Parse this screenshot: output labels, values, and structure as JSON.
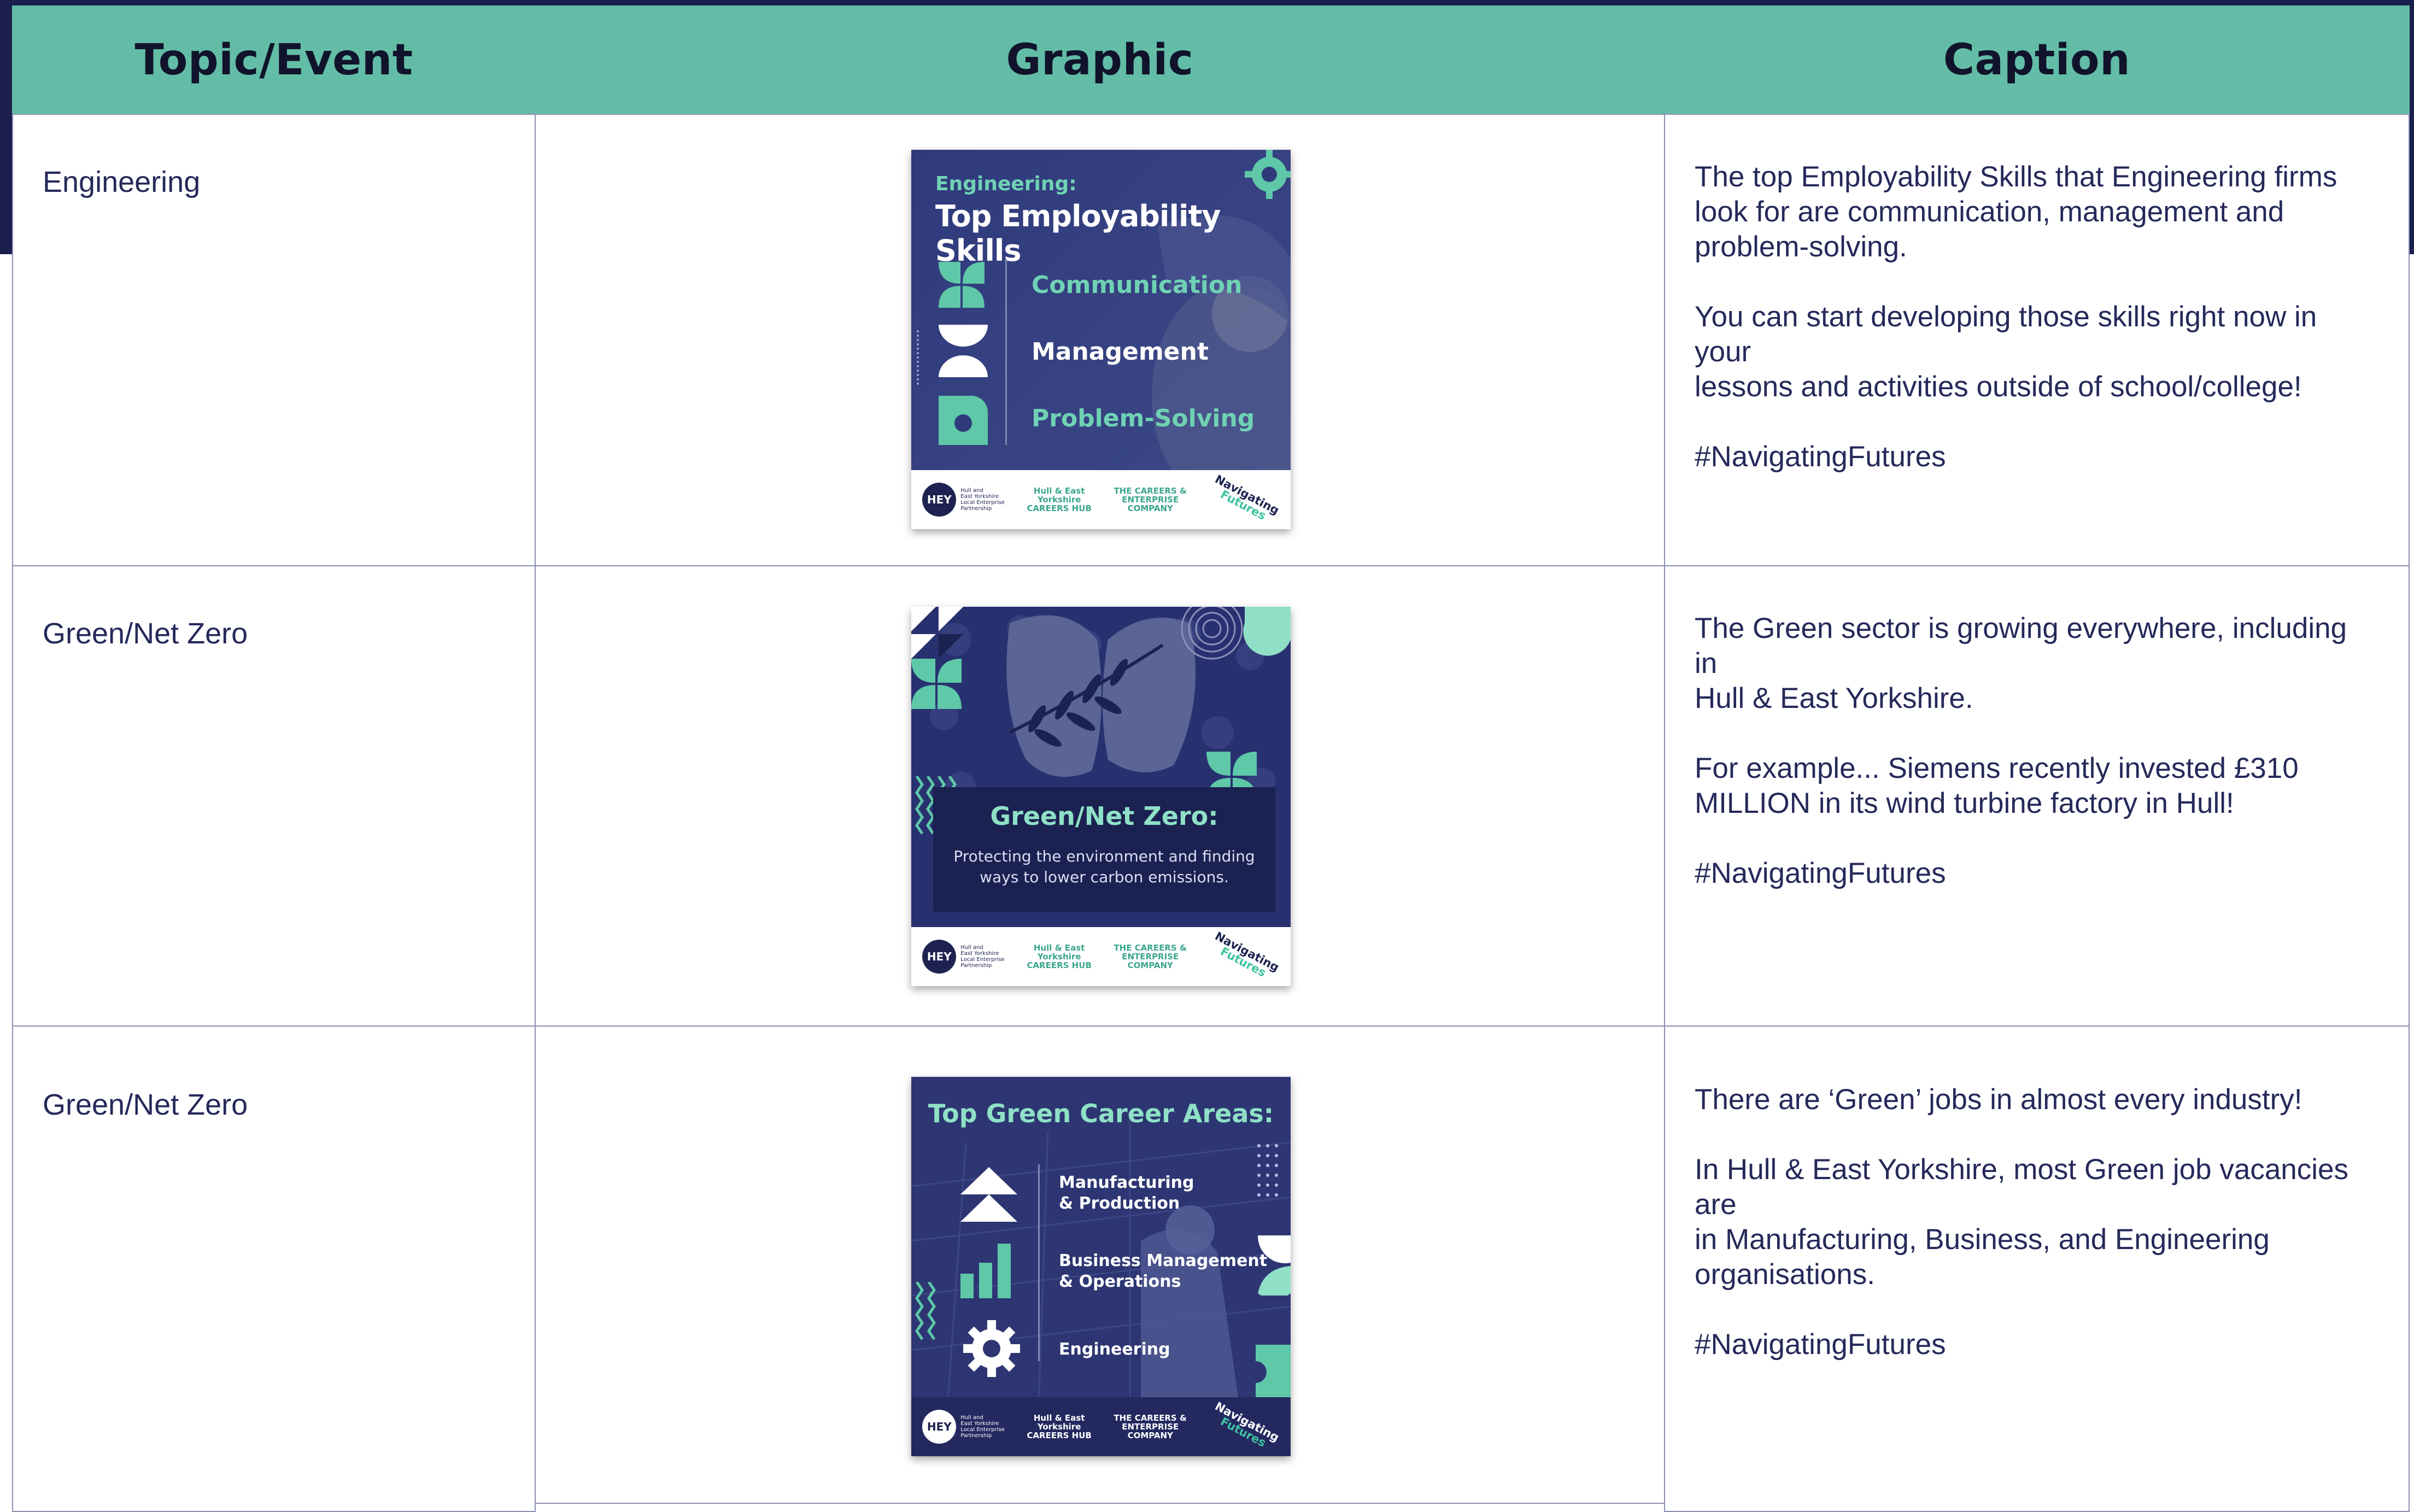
{
  "table": {
    "headers": {
      "topic": "Topic/Event",
      "graphic": "Graphic",
      "caption": "Caption"
    },
    "rows": [
      {
        "topic": "Engineering",
        "graphic": {
          "kicker": "Engineering:",
          "title": "Top Employability Skills",
          "skills": [
            "Communication",
            "Management",
            "Problem-Solving"
          ]
        },
        "caption": [
          "The top Employability Skills that Engineering firms\nlook for are communication, management and\nproblem-solving.",
          "You can start developing those skills right now in your\nlessons and activities outside of school/college!",
          "#NavigatingFutures"
        ]
      },
      {
        "topic": "Green/Net Zero",
        "graphic": {
          "title": "Green/Net Zero:",
          "subtitle": "Protecting the environment and finding\nways to lower carbon emissions."
        },
        "caption": [
          "The Green sector is growing everywhere, including in\nHull & East Yorkshire.",
          "For example... Siemens recently invested £310\nMILLION in its wind turbine factory in Hull!",
          "#NavigatingFutures"
        ]
      },
      {
        "topic": "Green/Net Zero",
        "graphic": {
          "title": "Top Green Career Areas:",
          "areas": [
            "Manufacturing\n& Production",
            "Business Management\n& Operations",
            "Engineering"
          ]
        },
        "caption": [
          "There are ‘Green’ jobs in almost every industry!",
          "In Hull & East Yorkshire, most Green job vacancies are\nin Manufacturing, Business, and Engineering\norganisations.",
          "#NavigatingFutures"
        ]
      }
    ]
  },
  "footer_logos": {
    "hey": "HEY",
    "lep": "Hull and\nEast Yorkshire\nLocal Enterprise\nPartnership",
    "hub": "Hull & East\nYorkshire\nCAREERS HUB",
    "cec": "THE CAREERS &\nENTERPRISE\nCOMPANY",
    "nav1": "Navigating",
    "nav2": "Futures"
  },
  "colors": {
    "header": "#63bda6",
    "navy": "#1d2250",
    "mint": "#6fd2b4"
  }
}
